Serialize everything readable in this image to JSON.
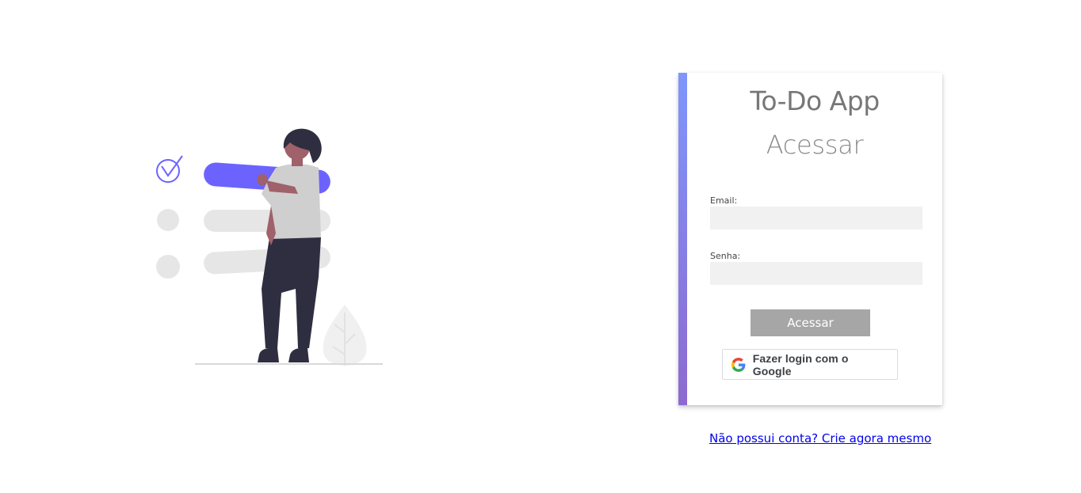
{
  "app": {
    "title": "To-Do App"
  },
  "login": {
    "heading": "Acessar",
    "email_label": "Email:",
    "email_value": "",
    "password_label": "Senha:",
    "password_value": "",
    "submit_label": "Acessar",
    "google_label": "Fazer login com o Google"
  },
  "footer": {
    "signup_link": "Não possui conta? Crie agora mesmo"
  },
  "colors": {
    "accent_top": "#7f96fb",
    "accent_bottom": "#8d6ad0",
    "illustration_primary": "#6c63ff",
    "button_bg": "#a6a6a6",
    "link": "#0000ee"
  },
  "icons": {
    "illustration": "todo-checklist-person-illustration",
    "google": "google-g-logo-icon"
  }
}
